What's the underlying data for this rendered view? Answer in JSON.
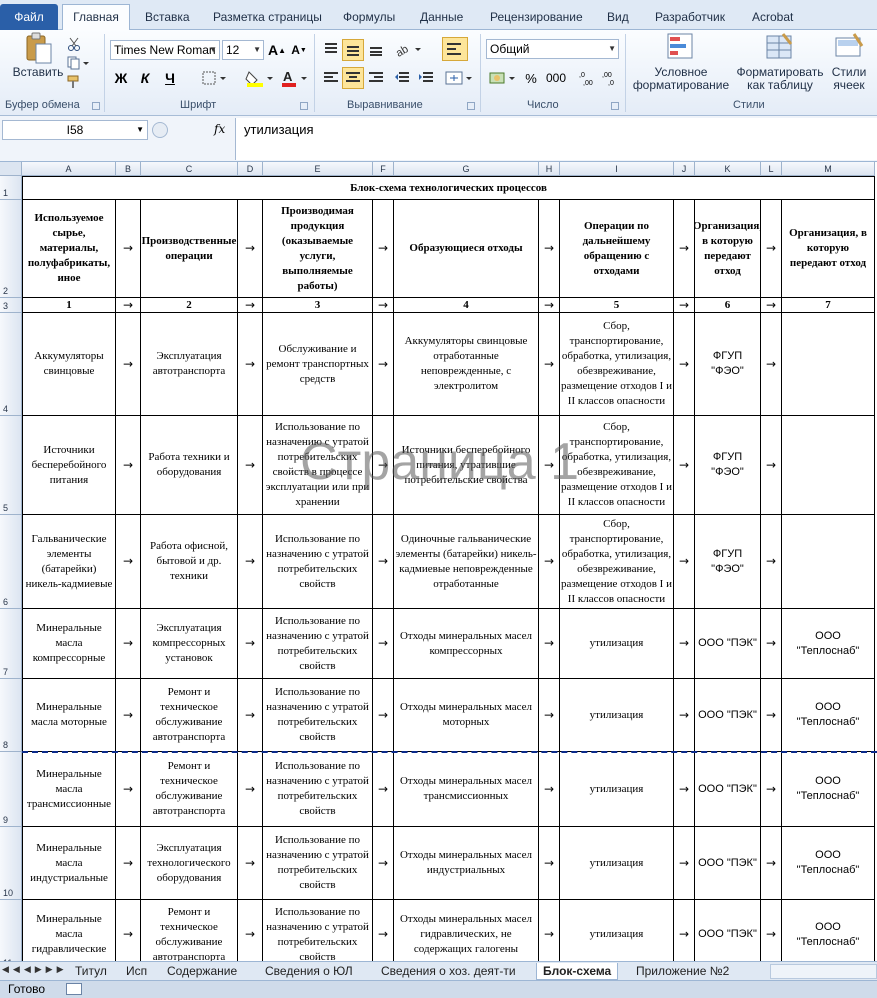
{
  "ribbon": {
    "tabs": [
      "Файл",
      "Главная",
      "Вставка",
      "Разметка страницы",
      "Формулы",
      "Данные",
      "Рецензирование",
      "Вид",
      "Разработчик",
      "Acrobat"
    ],
    "active_tab": "Главная",
    "groups": {
      "clipboard": "Буфер обмена",
      "font": "Шрифт",
      "alignment": "Выравнивание",
      "number": "Число",
      "styles": "Стили"
    },
    "paste_label": "Вставить",
    "font_name": "Times New Roman",
    "font_size": "12",
    "number_format": "Общий",
    "bold": "Ж",
    "italic": "К",
    "underline": "Ч",
    "percent": "%",
    "thousands": "000",
    "cond_format": "Условное форматирование",
    "format_table": "Форматировать как таблицу",
    "cell_styles": "Стили ячеек"
  },
  "formula_bar": {
    "name_box": "I58",
    "fx": "fx",
    "content": "утилизация"
  },
  "sheet": {
    "columns": [
      "A",
      "B",
      "C",
      "D",
      "E",
      "F",
      "G",
      "H",
      "I",
      "J",
      "K",
      "L",
      "M"
    ],
    "rows": [
      "1",
      "2",
      "3",
      "4",
      "5",
      "6",
      "7",
      "8",
      "9",
      "10",
      "11"
    ],
    "title": "Блок-схема технологических процессов",
    "arrow": "→",
    "headers": [
      "Используемое сырье, материалы, полуфабрикаты, иное",
      "Производственные операции",
      "Производимая продукция (оказываемые услуги, выполняемые работы)",
      "Образующиеся отходы",
      "Операции по дальнейшему обращению с отходами",
      "Организация, в которую передают отход",
      "Организация, в которую передают отход"
    ],
    "numbers": [
      "1",
      "2",
      "3",
      "4",
      "5",
      "6",
      "7"
    ],
    "data_rows": [
      [
        "Аккумуляторы свинцовые",
        "Эксплуатация автотранспорта",
        "Обслуживание и ремонт транспортных средств",
        "Аккумуляторы свинцовые отработанные неповрежденные, с электролитом",
        "Сбор, транспортирование, обработка, утилизация, обезвреживание, размещение отходов I и II классов опасности",
        "ФГУП \"ФЭО\"",
        ""
      ],
      [
        "Источники бесперебойного питания",
        "Работа техники и оборудования",
        "Использование по назначению с утратой потребительских свойств в процессе эксплуатации или при хранении",
        "Источники бесперебойного питания, утратившие потребительские свойства",
        "Сбор, транспортирование, обработка, утилизация, обезвреживание, размещение отходов I и II классов опасности",
        "ФГУП \"ФЭО\"",
        ""
      ],
      [
        "Гальванические элементы (батарейки) никель-кадмиевые",
        "Работа офисной, бытовой и др. техники",
        "Использование по назначению с утратой потребительских свойств",
        "Одиночные гальванические элементы (батарейки) никель-кадмиевые неповрежденные отработанные",
        "Сбор, транспортирование, обработка, утилизация, обезвреживание, размещение отходов I и II классов опасности",
        "ФГУП \"ФЭО\"",
        ""
      ],
      [
        "Минеральные масла компрессорные",
        "Эксплуатация компрессорных установок",
        "Использование по назначению с утратой потребительских свойств",
        "Отходы минеральных масел компрессорных",
        "утилизация",
        "ООО \"ПЭК\"",
        "ООО \"Теплоснаб\""
      ],
      [
        "Минеральные масла моторные",
        "Ремонт и техническое обслуживание автотранспорта",
        "Использование по назначению с утратой потребительских свойств",
        "Отходы минеральных масел моторных",
        "утилизация",
        "ООО \"ПЭК\"",
        "ООО \"Теплоснаб\""
      ],
      [
        "Минеральные масла трансмиссионные",
        "Ремонт и техническое обслуживание автотранспорта",
        "Использование по назначению с утратой потребительских свойств",
        "Отходы минеральных масел трансмиссионных",
        "утилизация",
        "ООО \"ПЭК\"",
        "ООО \"Теплоснаб\""
      ],
      [
        "Минеральные масла индустриальные",
        "Эксплуатация технологического оборудования",
        "Использование по назначению с утратой потребительских свойств",
        "Отходы минеральных масел индустриальных",
        "утилизация",
        "ООО \"ПЭК\"",
        "ООО \"Теплоснаб\""
      ],
      [
        "Минеральные масла гидравлические",
        "Ремонт и техническое обслуживание автотранспорта",
        "Использование по назначению с утратой потребительских свойств",
        "Отходы минеральных масел гидравлических, не содержащих галогены",
        "утилизация",
        "ООО \"ПЭК\"",
        "ООО \"Теплоснаб\""
      ]
    ],
    "watermark": "Страница 1"
  },
  "sheet_tabs": [
    "Титул",
    "Исп",
    "Содержание",
    "Сведения о ЮЛ",
    "Сведения о хоз. деят-ти",
    "Блок-схема",
    "Приложение №2"
  ],
  "active_sheet": "Блок-схема",
  "status": "Готово"
}
